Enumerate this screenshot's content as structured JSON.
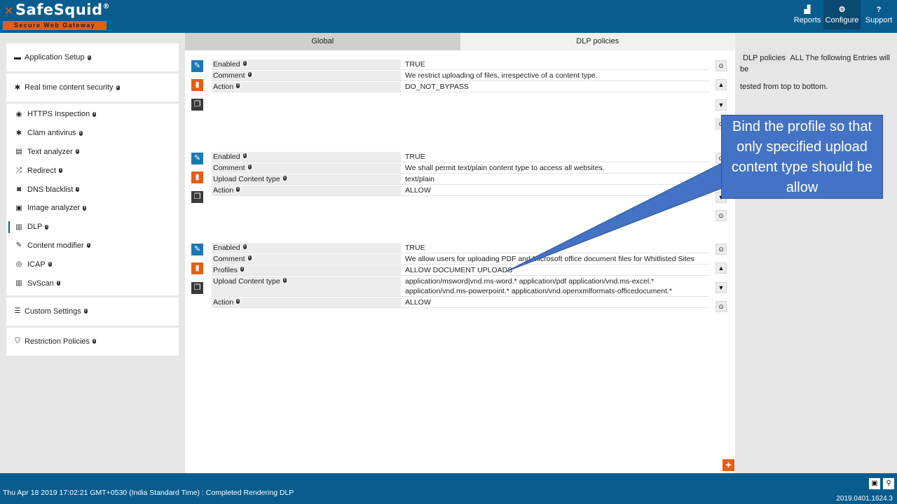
{
  "header": {
    "logo_text": "SafeSquid",
    "logo_reg": "®",
    "logo_subtitle": "Secure Web Gateway",
    "nav": [
      {
        "label": "Reports",
        "icon": "bar-chart-icon"
      },
      {
        "label": "Configure",
        "icon": "cogs-icon",
        "active": true
      },
      {
        "label": "Support",
        "icon": "question-icon"
      }
    ]
  },
  "sidebar": {
    "top": [
      {
        "label": "Application Setup",
        "icon": "briefcase-icon"
      },
      {
        "label": "Real time content security",
        "icon": "bug-icon"
      }
    ],
    "items": [
      {
        "label": "HTTPS Inspection",
        "icon": "eye-icon"
      },
      {
        "label": "Clam antivirus",
        "icon": "asterisk-icon"
      },
      {
        "label": "Text analyzer",
        "icon": "file-text-icon"
      },
      {
        "label": "Redirect",
        "icon": "random-icon"
      },
      {
        "label": "DNS blacklist",
        "icon": "dns-icon"
      },
      {
        "label": "Image analyzer",
        "icon": "image-icon"
      },
      {
        "label": "DLP",
        "icon": "barcode-icon",
        "active": true
      },
      {
        "label": "Content modifier",
        "icon": "edit-icon"
      },
      {
        "label": "ICAP",
        "icon": "life-ring-icon"
      },
      {
        "label": "SvScan",
        "icon": "barcode-icon"
      }
    ],
    "bottom": [
      {
        "label": "Custom Settings",
        "icon": "sliders-icon"
      },
      {
        "label": "Restriction Policies",
        "icon": "shield-icon"
      }
    ]
  },
  "tabs": {
    "global": "Global",
    "dlp": "DLP policies"
  },
  "entries": [
    {
      "rows": [
        {
          "key": "Enabled",
          "value": "TRUE"
        },
        {
          "key": "Comment",
          "value": "We restrict uploading of files, irrespective of a content type."
        },
        {
          "key": "Action",
          "value": "DO_NOT_BYPASS"
        }
      ]
    },
    {
      "rows": [
        {
          "key": "Enabled",
          "value": "TRUE"
        },
        {
          "key": "Comment",
          "value": "We shall permit text/plain content type to access all websites."
        },
        {
          "key": "Upload Content type",
          "value": "text/plain"
        },
        {
          "key": "Action",
          "value": "ALLOW"
        }
      ]
    },
    {
      "rows": [
        {
          "key": "Enabled",
          "value": "TRUE"
        },
        {
          "key": "Comment",
          "value": "We allow users for uploading PDF and Microsoft office document files for Whitlisted Sites"
        },
        {
          "key": "Profiles",
          "value": "ALLOW DOCUMENT UPLOADS"
        },
        {
          "key": "Upload Content type",
          "value": "application/msword|vnd.ms-word.*   application/pdf   application/vnd.ms-excel.*\napplication/vnd.ms-powerpoint.*   application/vnd.openxmlformats-officedocument.*"
        },
        {
          "key": "Action",
          "value": "ALLOW"
        }
      ]
    }
  ],
  "right_panel": {
    "tag": "DLP policies",
    "text1": "ALL The following Entries will be",
    "text2": "tested from top to bottom."
  },
  "callout": {
    "text": "Bind the profile so that only specified upload content type should be allow"
  },
  "footer": {
    "status": "Thu Apr 18 2019 17:02:21 GMT+0530 (India Standard Time) : Completed Rendering DLP",
    "version": "2019.0401.1624.3"
  },
  "colors": {
    "brand_blue": "#085d8e",
    "accent_orange": "#e85c14",
    "edit_blue": "#1a79b5",
    "callout_blue": "#4472c4"
  }
}
